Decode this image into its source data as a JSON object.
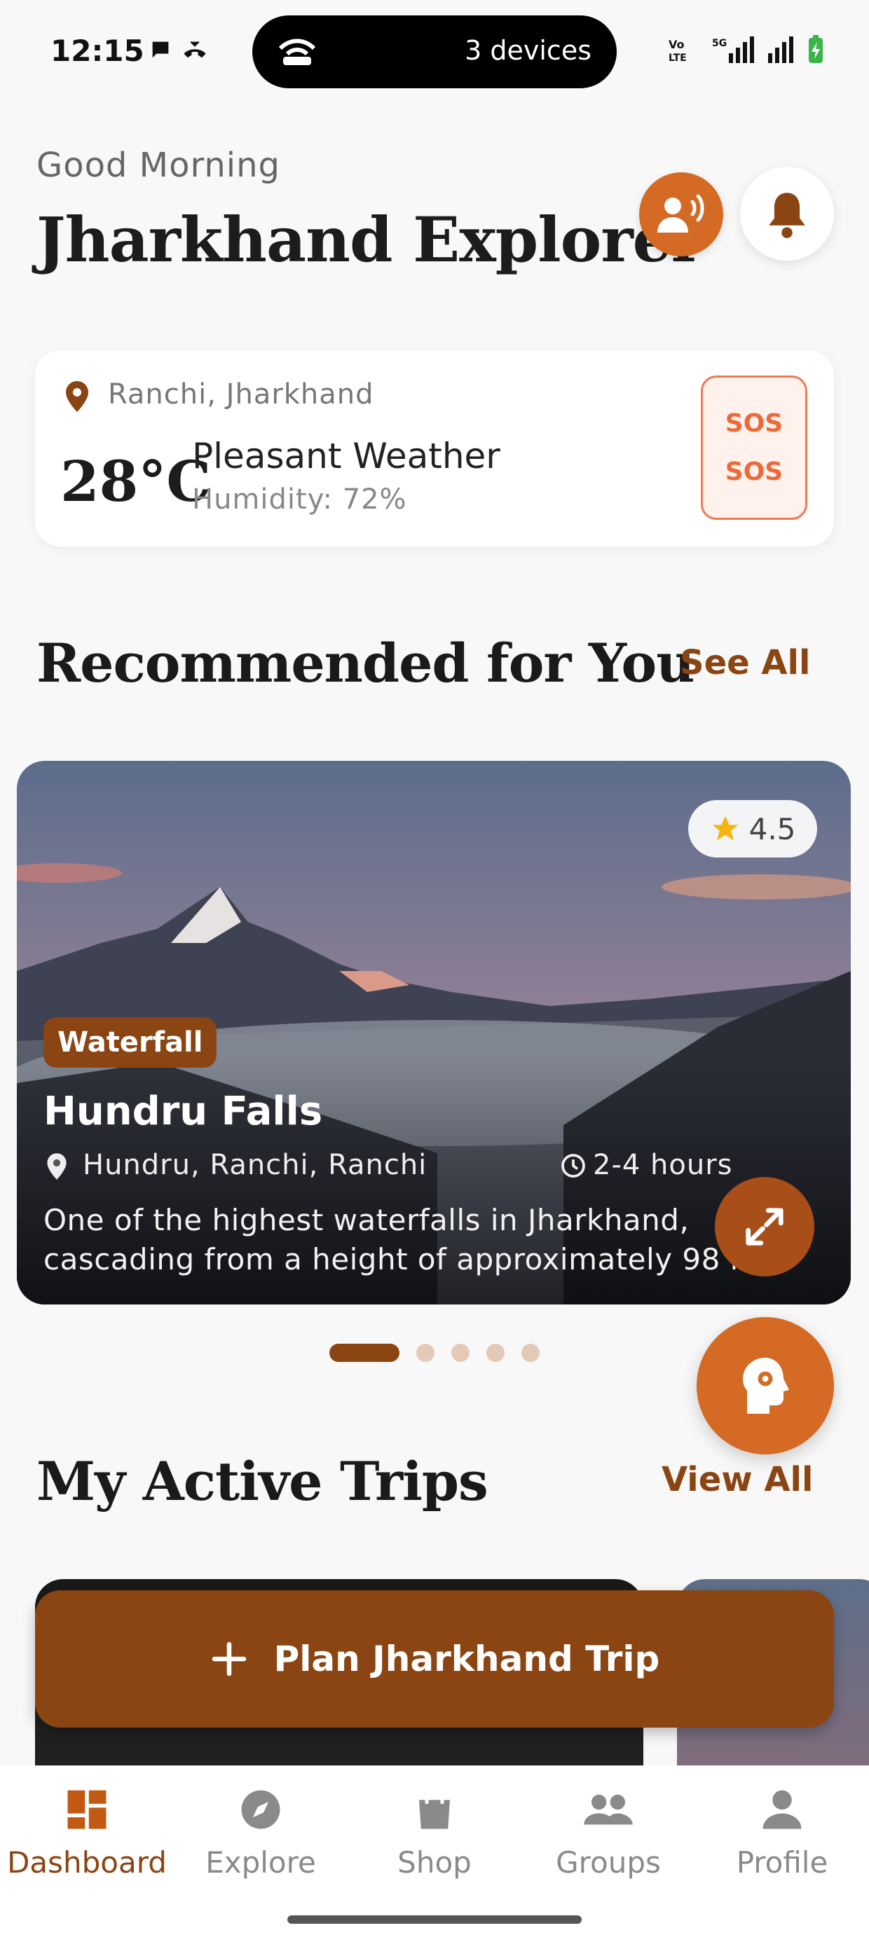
{
  "status_bar": {
    "time": "12:15",
    "island_text": "3 devices"
  },
  "header": {
    "greeting": "Good Morning",
    "title": "Jharkhand Explorer"
  },
  "weather": {
    "location": "Ranchi, Jharkhand",
    "temperature": "28°C",
    "condition": "Pleasant Weather",
    "humidity": "Humidity: 72%",
    "sos_top": "SOS",
    "sos_bottom": "SOS"
  },
  "recommended": {
    "title": "Recommended for You",
    "link": "See All",
    "card": {
      "rating": "4.5",
      "category": "Waterfall",
      "name": "Hundru Falls",
      "location": "Hundru, Ranchi, Ranchi",
      "duration": "2-4 hours",
      "description_line1": "One of the highest waterfalls in Jharkhand,",
      "description_line2": "cascading from a height of approximately 98 m..."
    },
    "page_count": 5,
    "active_page": 1
  },
  "trips": {
    "title": "My Active Trips",
    "link": "View All"
  },
  "plan_button": {
    "label": "Plan Jharkhand Trip"
  },
  "nav": [
    {
      "label": "Dashboard",
      "icon": "dashboard-icon",
      "active": true
    },
    {
      "label": "Explore",
      "icon": "compass-icon",
      "active": false
    },
    {
      "label": "Shop",
      "icon": "shopping-bag-icon",
      "active": false
    },
    {
      "label": "Groups",
      "icon": "groups-icon",
      "active": false
    },
    {
      "label": "Profile",
      "icon": "person-icon",
      "active": false
    }
  ],
  "colors": {
    "accent": "#8b4513",
    "orange": "#d46a23",
    "sos": "#ec6a3a"
  }
}
